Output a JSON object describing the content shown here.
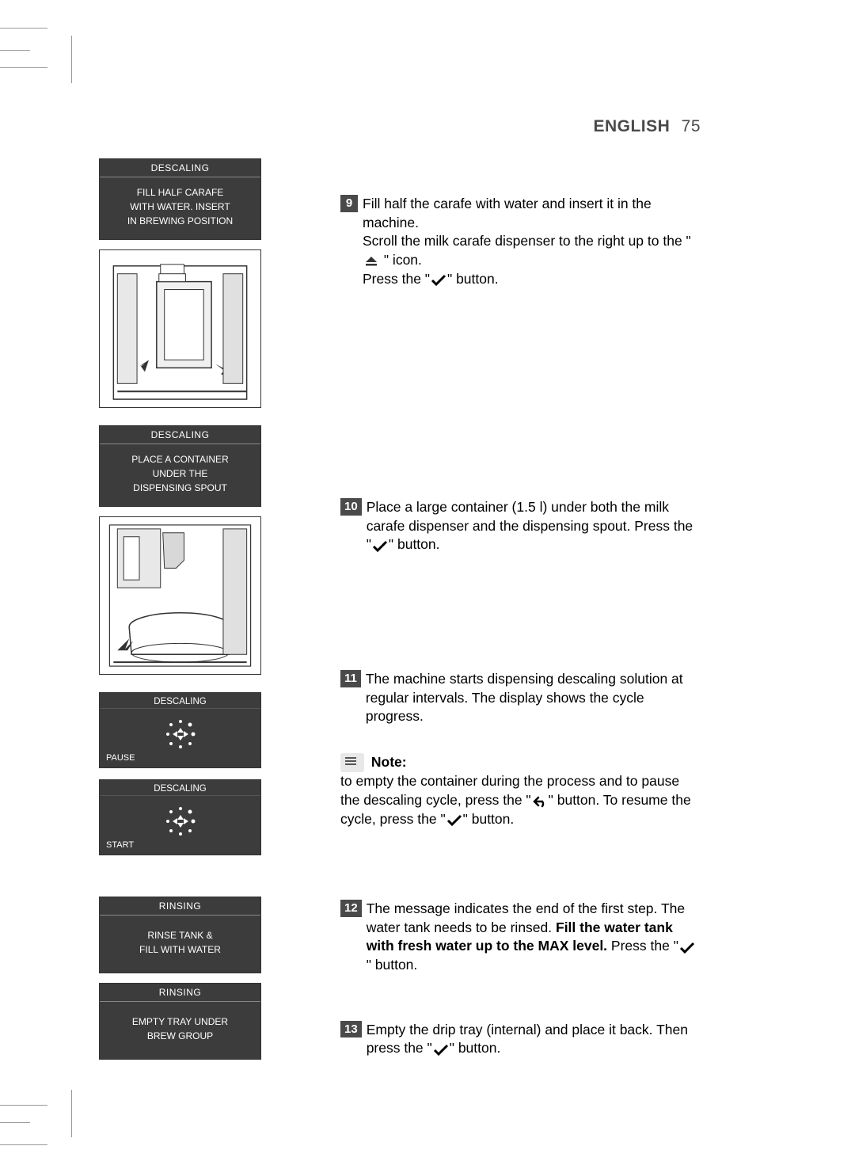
{
  "header": {
    "language": "ENGLISH",
    "page_number": "75"
  },
  "display1": {
    "title": "DESCALING",
    "line1": "FILL HALF CARAFE",
    "line2": "WITH WATER. INSERT",
    "line3": "IN BREWING POSITION"
  },
  "display2": {
    "title": "DESCALING",
    "line1": "PLACE A CONTAINER",
    "line2": "UNDER THE",
    "line3": "DISPENSING SPOUT"
  },
  "progress1": {
    "title": "DESCALING",
    "label": "PAUSE"
  },
  "progress2": {
    "title": "DESCALING",
    "label": "START"
  },
  "display3": {
    "title": "RINSING",
    "line1": "RINSE TANK &",
    "line2": "FILL WITH WATER"
  },
  "display4": {
    "title": "RINSING",
    "line1": "EMPTY TRAY UNDER",
    "line2": "BREW GROUP"
  },
  "step9": {
    "num": "9",
    "line1a": "Fill half the carafe with water and insert it in the machine.",
    "line2a": "Scroll the milk carafe dispenser to the right up to the \" ",
    "line2b": " \" icon.",
    "line3a": "Press the \"",
    "line3b": "\" button."
  },
  "step10": {
    "num": "10",
    "line1a": " Place a large container (1.5 l) under both the milk carafe dispenser and the dispensing spout. Press the \"",
    "line1b": "\" button."
  },
  "step11": {
    "num": "11",
    "line1": "The machine starts dispensing descaling solution at regular intervals. The display shows the cycle progress."
  },
  "note": {
    "label": "Note:",
    "text1": "to empty the container during the process and to pause the descaling cycle, press the \"",
    "text2": "\" button. To resume the cycle, press the \"",
    "text3": "\" button."
  },
  "step12": {
    "num": "12",
    "line1a": "The message indicates the end of the first step. The water tank needs to be rinsed. ",
    "bold": "Fill the water tank with fresh water up to the MAX level.",
    "line1b": " Press the \"",
    "line1c": "\" button."
  },
  "step13": {
    "num": "13",
    "line1a": "Empty the drip tray (internal) and place it back. Then press the \"",
    "line1b": "\" button."
  }
}
